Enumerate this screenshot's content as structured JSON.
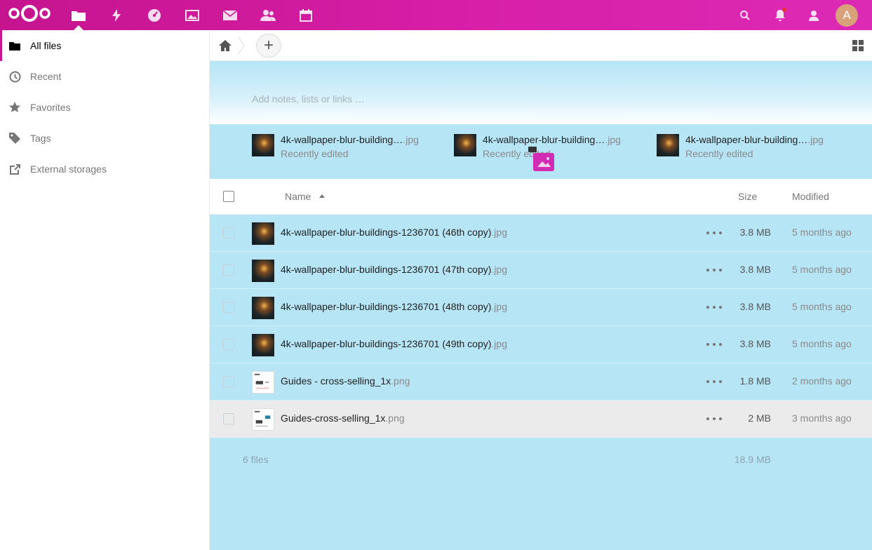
{
  "header": {
    "apps": [
      {
        "name": "files-icon",
        "active": true
      },
      {
        "name": "activity-icon",
        "active": false
      },
      {
        "name": "dashboard-icon",
        "active": false
      },
      {
        "name": "photos-icon",
        "active": false
      },
      {
        "name": "mail-icon",
        "active": false
      },
      {
        "name": "contacts-icon",
        "active": false
      },
      {
        "name": "calendar-icon",
        "active": false
      }
    ],
    "avatar_letter": "A"
  },
  "sidebar": {
    "items": [
      {
        "label": "All files",
        "icon": "folder-icon",
        "active": true
      },
      {
        "label": "Recent",
        "icon": "clock-icon"
      },
      {
        "label": "Favorites",
        "icon": "star-icon"
      },
      {
        "label": "Tags",
        "icon": "tag-icon"
      },
      {
        "label": "External storages",
        "icon": "external-link-icon"
      }
    ]
  },
  "controls": {
    "add_label": "+"
  },
  "notes": {
    "placeholder": "Add notes, lists or links …"
  },
  "recent": [
    {
      "name": "4k-wallpaper-blur-building…",
      "ext": ".jpg",
      "sub": "Recently edited"
    },
    {
      "name": "4k-wallpaper-blur-building…",
      "ext": ".jpg",
      "sub": "Recently edited"
    },
    {
      "name": "4k-wallpaper-blur-building…",
      "ext": ".jpg",
      "sub": "Recently edited"
    }
  ],
  "table": {
    "headers": {
      "name": "Name",
      "size": "Size",
      "modified": "Modified"
    },
    "rows": [
      {
        "name": "4k-wallpaper-blur-buildings-1236701 (46th copy)",
        "ext": ".jpg",
        "size": "3.8 MB",
        "modified": "5 months ago",
        "type": "photo"
      },
      {
        "name": "4k-wallpaper-blur-buildings-1236701 (47th copy)",
        "ext": ".jpg",
        "size": "3.8 MB",
        "modified": "5 months ago",
        "type": "photo"
      },
      {
        "name": "4k-wallpaper-blur-buildings-1236701 (48th copy)",
        "ext": ".jpg",
        "size": "3.8 MB",
        "modified": "5 months ago",
        "type": "photo"
      },
      {
        "name": "4k-wallpaper-blur-buildings-1236701 (49th copy)",
        "ext": ".jpg",
        "size": "3.8 MB",
        "modified": "5 months ago",
        "type": "photo"
      },
      {
        "name": "Guides - cross-selling_1x",
        "ext": ".png",
        "size": "1.8 MB",
        "modified": "2 months ago",
        "type": "doc"
      },
      {
        "name": "Guides-cross-selling_1x",
        "ext": ".png",
        "size": "2 MB",
        "modified": "3 months ago",
        "type": "doc"
      }
    ]
  },
  "summary": {
    "count": "6 files",
    "size": "18.9 MB"
  },
  "colors": {
    "brand": "#c9158f",
    "drop_zone": "#b6e5f6"
  }
}
